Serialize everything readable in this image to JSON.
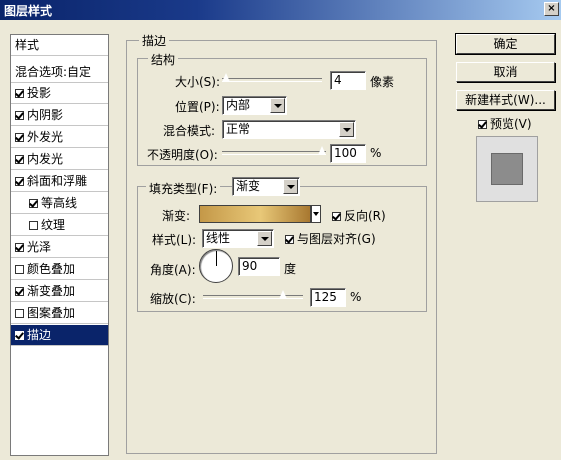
{
  "window": {
    "title": "图层样式",
    "close_label": "×"
  },
  "style_list": {
    "header": "样式",
    "blend_options": "混合选项:自定",
    "items": [
      {
        "label": "投影",
        "checked": true
      },
      {
        "label": "内阴影",
        "checked": true
      },
      {
        "label": "外发光",
        "checked": true
      },
      {
        "label": "内发光",
        "checked": true
      },
      {
        "label": "斜面和浮雕",
        "checked": true
      },
      {
        "label": "等高线",
        "checked": true
      },
      {
        "label": "纹理",
        "checked": false
      },
      {
        "label": "光泽",
        "checked": true
      },
      {
        "label": "颜色叠加",
        "checked": false
      },
      {
        "label": "渐变叠加",
        "checked": true
      },
      {
        "label": "图案叠加",
        "checked": false
      },
      {
        "label": "描边",
        "checked": true,
        "selected": true
      }
    ]
  },
  "stroke": {
    "group_title": "描边",
    "structure": {
      "title": "结构",
      "size_label": "大小(S):",
      "size_value": "4",
      "size_unit": "像素",
      "size_slider": 0.0,
      "position_label": "位置(P):",
      "position_value": "内部",
      "blend_label": "混合模式:",
      "blend_value": "正常",
      "opacity_label": "不透明度(O):",
      "opacity_value": "100",
      "opacity_unit": "%",
      "opacity_slider": 1.0
    },
    "fill": {
      "type_label": "填充类型(F):",
      "type_value": "渐变",
      "gradient_label": "渐变:",
      "reverse_label": "反向(R)",
      "reverse_checked": true,
      "style_label": "样式(L):",
      "style_value": "线性",
      "align_label": "与图层对齐(G)",
      "align_checked": true,
      "angle_label": "角度(A):",
      "angle_value": "90",
      "angle_unit": "度",
      "scale_label": "缩放(C):",
      "scale_value": "125",
      "scale_unit": "%",
      "scale_slider": 0.83
    }
  },
  "buttons": {
    "ok": "确定",
    "cancel": "取消",
    "new_style": "新建样式(W)...",
    "preview": "预览(V)",
    "preview_checked": true
  },
  "colors": {
    "title_bar": "#0a246a",
    "selection": "#0a246a",
    "gradient_start": "#c49848",
    "gradient_mid": "#e8c878",
    "gradient_end": "#a87830"
  }
}
